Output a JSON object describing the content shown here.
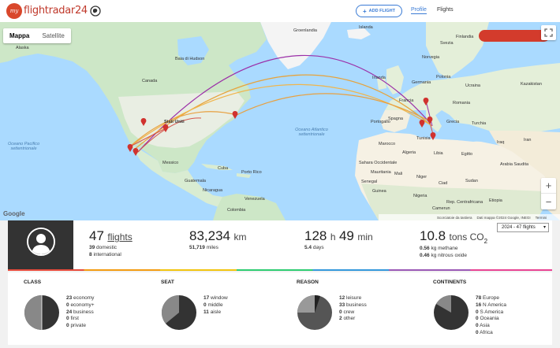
{
  "header": {
    "logo_badge": "my",
    "logo_text": "flightradar24",
    "add_flight_label": "ADD FLIGHT",
    "nav": {
      "profile": "Profile",
      "flights": "Flights"
    }
  },
  "map": {
    "toggle": {
      "map": "Mappa",
      "satellite": "Satellite"
    },
    "zoom_in": "+",
    "zoom_out": "−",
    "google": "Google",
    "attribution": [
      "Scorciatoie da tastiera",
      "Dati mappa ©2024 Google, INEGI",
      "Termini"
    ],
    "labels": {
      "islanda": "Islanda",
      "svezia": "Svezia",
      "finlandia": "Finlandia",
      "norvegia": "Norvegia",
      "irlanda": "Irlanda",
      "germania": "Germania",
      "polonia": "Polonia",
      "ucraina": "Ucraina",
      "kazakistan": "Kazakistan",
      "francia": "Francia",
      "spagna": "Spagna",
      "portogallo": "Portogallo",
      "grecia": "Grecia",
      "turchia": "Turchia",
      "romania": "Romania",
      "marocco": "Marocco",
      "algeria": "Algeria",
      "tunisia": "Tunisia",
      "libia": "Libia",
      "egitto": "Egitto",
      "mali": "Mali",
      "niger": "Niger",
      "ciad": "Ciad",
      "sudan": "Sudan",
      "nigeria": "Nigeria",
      "etiopia": "Etiopia",
      "iraq": "Iraq",
      "iran": "Iran",
      "arabia_saudita": "Arabia Saudita",
      "sahara": "Sahara Occidentale",
      "mauritania": "Mauritania",
      "senegal": "Senegal",
      "guinea": "Guinea",
      "canada": "Canada",
      "stati_uniti": "Stati Uniti",
      "messico": "Messico",
      "cuba": "Cuba",
      "guatemala": "Guatemala",
      "nicaragua": "Nicaragua",
      "venezuela": "Venezuela",
      "colombia": "Colombia",
      "portorico": "Porto Rico",
      "alaska": "Alaska",
      "hudson": "Baia di Hudson",
      "atlantico": "Oceano Atlantico settentrionale",
      "pacifico": "Oceano Pacifico settentrionale",
      "groenlandia": "Groenlandia",
      "cma": "Rep. Centrafricana",
      "cameroon": "Camerun"
    }
  },
  "stats": {
    "flights": {
      "value": "47",
      "unit": "flights",
      "domestic_count": "39",
      "domestic_label": "domestic",
      "international_count": "8",
      "international_label": "international"
    },
    "distance": {
      "value": "83,234",
      "unit": "km",
      "miles_value": "51,719",
      "miles_label": "miles"
    },
    "duration": {
      "hours": "128",
      "h_unit": "h",
      "minutes": "49",
      "min_unit": "min",
      "days_value": "5.4",
      "days_label": "days"
    },
    "co2": {
      "value": "10.8",
      "unit": "tons CO",
      "sub": "2",
      "methane_value": "0.56",
      "methane_label": "kg methane",
      "nitrous_value": "0.46",
      "nitrous_label": "kg nitrous oxide"
    },
    "year_select": "2024 - 47 flights"
  },
  "breakdown": {
    "class": {
      "title": "CLASS",
      "items": [
        {
          "count": "23",
          "label": "economy"
        },
        {
          "count": "0",
          "label": "economy+"
        },
        {
          "count": "24",
          "label": "business"
        },
        {
          "count": "0",
          "label": "first"
        },
        {
          "count": "0",
          "label": "private"
        }
      ]
    },
    "seat": {
      "title": "SEAT",
      "items": [
        {
          "count": "17",
          "label": "window"
        },
        {
          "count": "0",
          "label": "middle"
        },
        {
          "count": "11",
          "label": "aisle"
        }
      ]
    },
    "reason": {
      "title": "REASON",
      "items": [
        {
          "count": "12",
          "label": "leisure"
        },
        {
          "count": "33",
          "label": "business"
        },
        {
          "count": "0",
          "label": "crew"
        },
        {
          "count": "2",
          "label": "other"
        }
      ]
    },
    "continents": {
      "title": "CONTINENTS",
      "items": [
        {
          "count": "78",
          "label": "Europe"
        },
        {
          "count": "16",
          "label": "N America"
        },
        {
          "count": "0",
          "label": "S America"
        },
        {
          "count": "0",
          "label": "Oceania"
        },
        {
          "count": "0",
          "label": "Asia"
        },
        {
          "count": "0",
          "label": "Africa"
        }
      ]
    }
  }
}
